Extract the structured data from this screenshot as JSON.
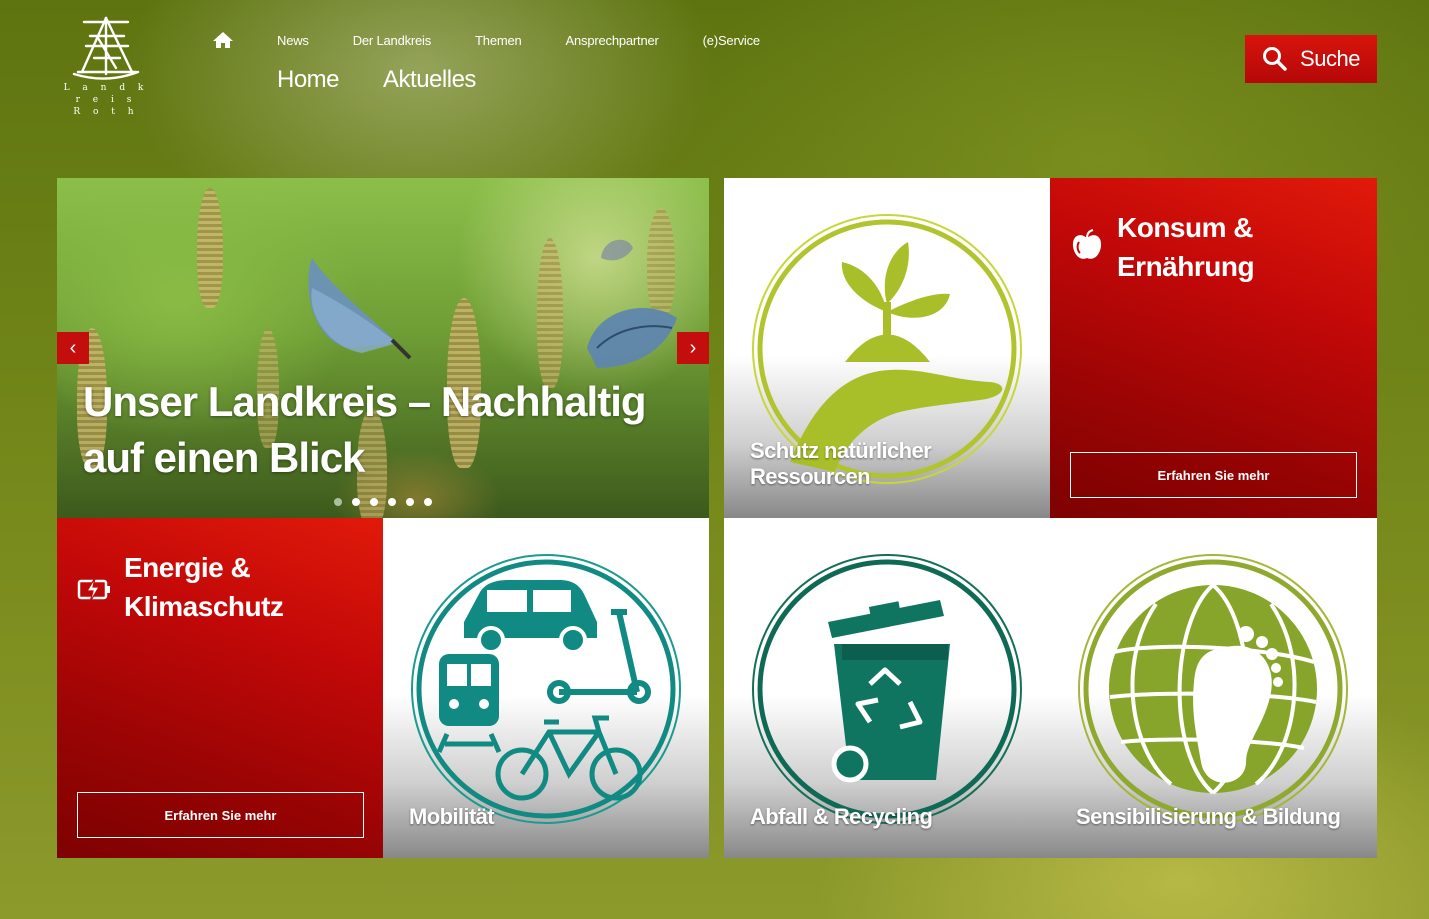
{
  "logo": {
    "text": "L a n d k r e i s\nR o t h"
  },
  "nav": {
    "home_icon": "home-icon",
    "items": [
      "News",
      "Der Landkreis",
      "Themen",
      "Ansprechpartner",
      "(e)Service"
    ],
    "breadcrumb": [
      "Home",
      "Aktuelles"
    ]
  },
  "search": {
    "label": "Suche",
    "icon": "search-icon"
  },
  "slider": {
    "title": "Unser Landkreis – Nachhaltig auf einen Blick",
    "prev": "‹",
    "next": "›",
    "dots": 6,
    "active_dot": 0
  },
  "tiles": {
    "ressourcen": {
      "label": "Schutz natürlicher Ressourcen"
    },
    "konsum": {
      "title": "Konsum & Ernährung",
      "icon": "apple-icon",
      "button": "Erfahren Sie mehr"
    },
    "energie": {
      "title": "Energie & Klimaschutz",
      "icon": "battery-charge-icon",
      "button": "Erfahren Sie mehr"
    },
    "mobilitaet": {
      "label": "Mobilität"
    },
    "abfall": {
      "label": "Abfall & Recycling"
    },
    "bildung": {
      "label": "Sensibilisierung & Bildung"
    }
  },
  "colors": {
    "red": "#c20808",
    "teal": "#108a82",
    "lime": "#a8bf2a",
    "olive": "#87a52a"
  }
}
